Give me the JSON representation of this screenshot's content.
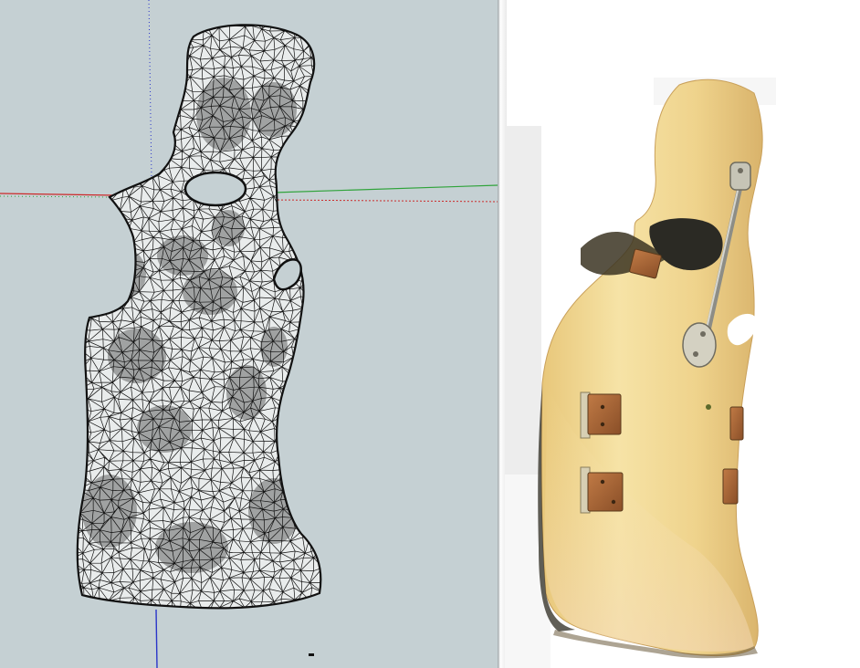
{
  "left_panel": {
    "view": "wireframe-mesh",
    "background_color": "#c5d0d3",
    "axes": {
      "red_axis_color": "#cc2a2a",
      "green_axis_color": "#2fa33a",
      "blue_axis_color": "#2a35c9"
    }
  },
  "right_panel": {
    "view": "textured-model",
    "surface_color": "#efd38c",
    "hardware_color": "#a26233"
  }
}
